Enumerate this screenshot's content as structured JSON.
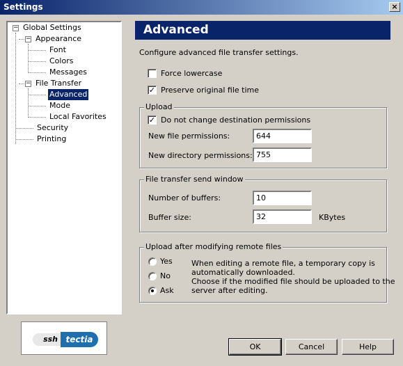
{
  "window": {
    "title": "Settings",
    "close_glyph": "×"
  },
  "tree": {
    "items": [
      {
        "label": "Global Settings",
        "expander": "−"
      },
      {
        "label": "Appearance",
        "expander": "−"
      },
      {
        "label": "Font"
      },
      {
        "label": "Colors"
      },
      {
        "label": "Messages"
      },
      {
        "label": "File Transfer",
        "expander": "−"
      },
      {
        "label": "Advanced"
      },
      {
        "label": "Mode"
      },
      {
        "label": "Local Favorites"
      },
      {
        "label": "Security"
      },
      {
        "label": "Printing"
      }
    ]
  },
  "logo": {
    "left": "ssh",
    "right": "tectia"
  },
  "panel": {
    "title": "Advanced",
    "description": "Configure advanced file transfer settings.",
    "force_lowercase": {
      "label": "Force lowercase",
      "checked": false
    },
    "preserve_time": {
      "label": "Preserve original file time",
      "checked": true
    }
  },
  "upload": {
    "group_label": "Upload",
    "no_change_perms": {
      "label": "Do not change destination permissions",
      "checked": true
    },
    "file_perms_label": "New file permissions:",
    "file_perms_value": "644",
    "dir_perms_label": "New directory permissions:",
    "dir_perms_value": "755"
  },
  "send_window": {
    "group_label": "File transfer send window",
    "buffers_label": "Number of buffers:",
    "buffers_value": "10",
    "size_label": "Buffer size:",
    "size_value": "32",
    "size_unit": "KBytes"
  },
  "upload_after": {
    "group_label": "Upload after modifying remote files",
    "options": [
      {
        "label": "Yes",
        "selected": false
      },
      {
        "label": "No",
        "selected": false
      },
      {
        "label": "Ask",
        "selected": true
      }
    ],
    "help_line1": "When editing a remote file, a temporary copy is",
    "help_line2": "automatically downloaded.",
    "help_line3": "Choose if the modified file should be uploaded to the",
    "help_line4": "server after editing."
  },
  "buttons": {
    "ok": "OK",
    "cancel": "Cancel",
    "help": "Help"
  },
  "check_glyph": "✓"
}
